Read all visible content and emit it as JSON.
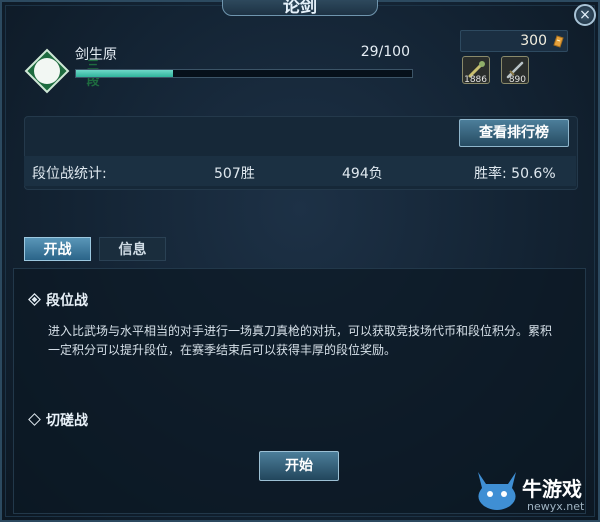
{
  "window": {
    "title": "论剑",
    "close_label": "×"
  },
  "player": {
    "rank_badge": [
      "三",
      "段"
    ],
    "name": "剑生原",
    "progress_text": "29/100",
    "progress_value": 29,
    "progress_max": 100
  },
  "currency": {
    "amount": "300",
    "icon": "gold-coin-icon"
  },
  "items": [
    {
      "icon": "scroll-icon",
      "count": "1886"
    },
    {
      "icon": "sword-icon",
      "count": "890"
    }
  ],
  "leaderboard_button": "查看排行榜",
  "stats": {
    "label": "段位战统计:",
    "wins": "507胜",
    "losses": "494负",
    "win_rate": "胜率: 50.6%"
  },
  "tabs": [
    {
      "label": "开战",
      "active": true
    },
    {
      "label": "信息",
      "active": false
    }
  ],
  "modes": [
    {
      "label": "段位战",
      "selected": true,
      "description": "进入比武场与水平相当的对手进行一场真刀真枪的对抗，可以获取竞技场代币和段位积分。累积一定积分可以提升段位，在赛季结束后可以获得丰厚的段位奖励。"
    },
    {
      "label": "切磋战",
      "selected": false
    }
  ],
  "start_button": "开始",
  "watermark": {
    "name": "牛游戏",
    "url": "newyx.net"
  },
  "colors": {
    "accent": "#2fb39b",
    "button": "#3a6a86",
    "panel": "#162838"
  }
}
